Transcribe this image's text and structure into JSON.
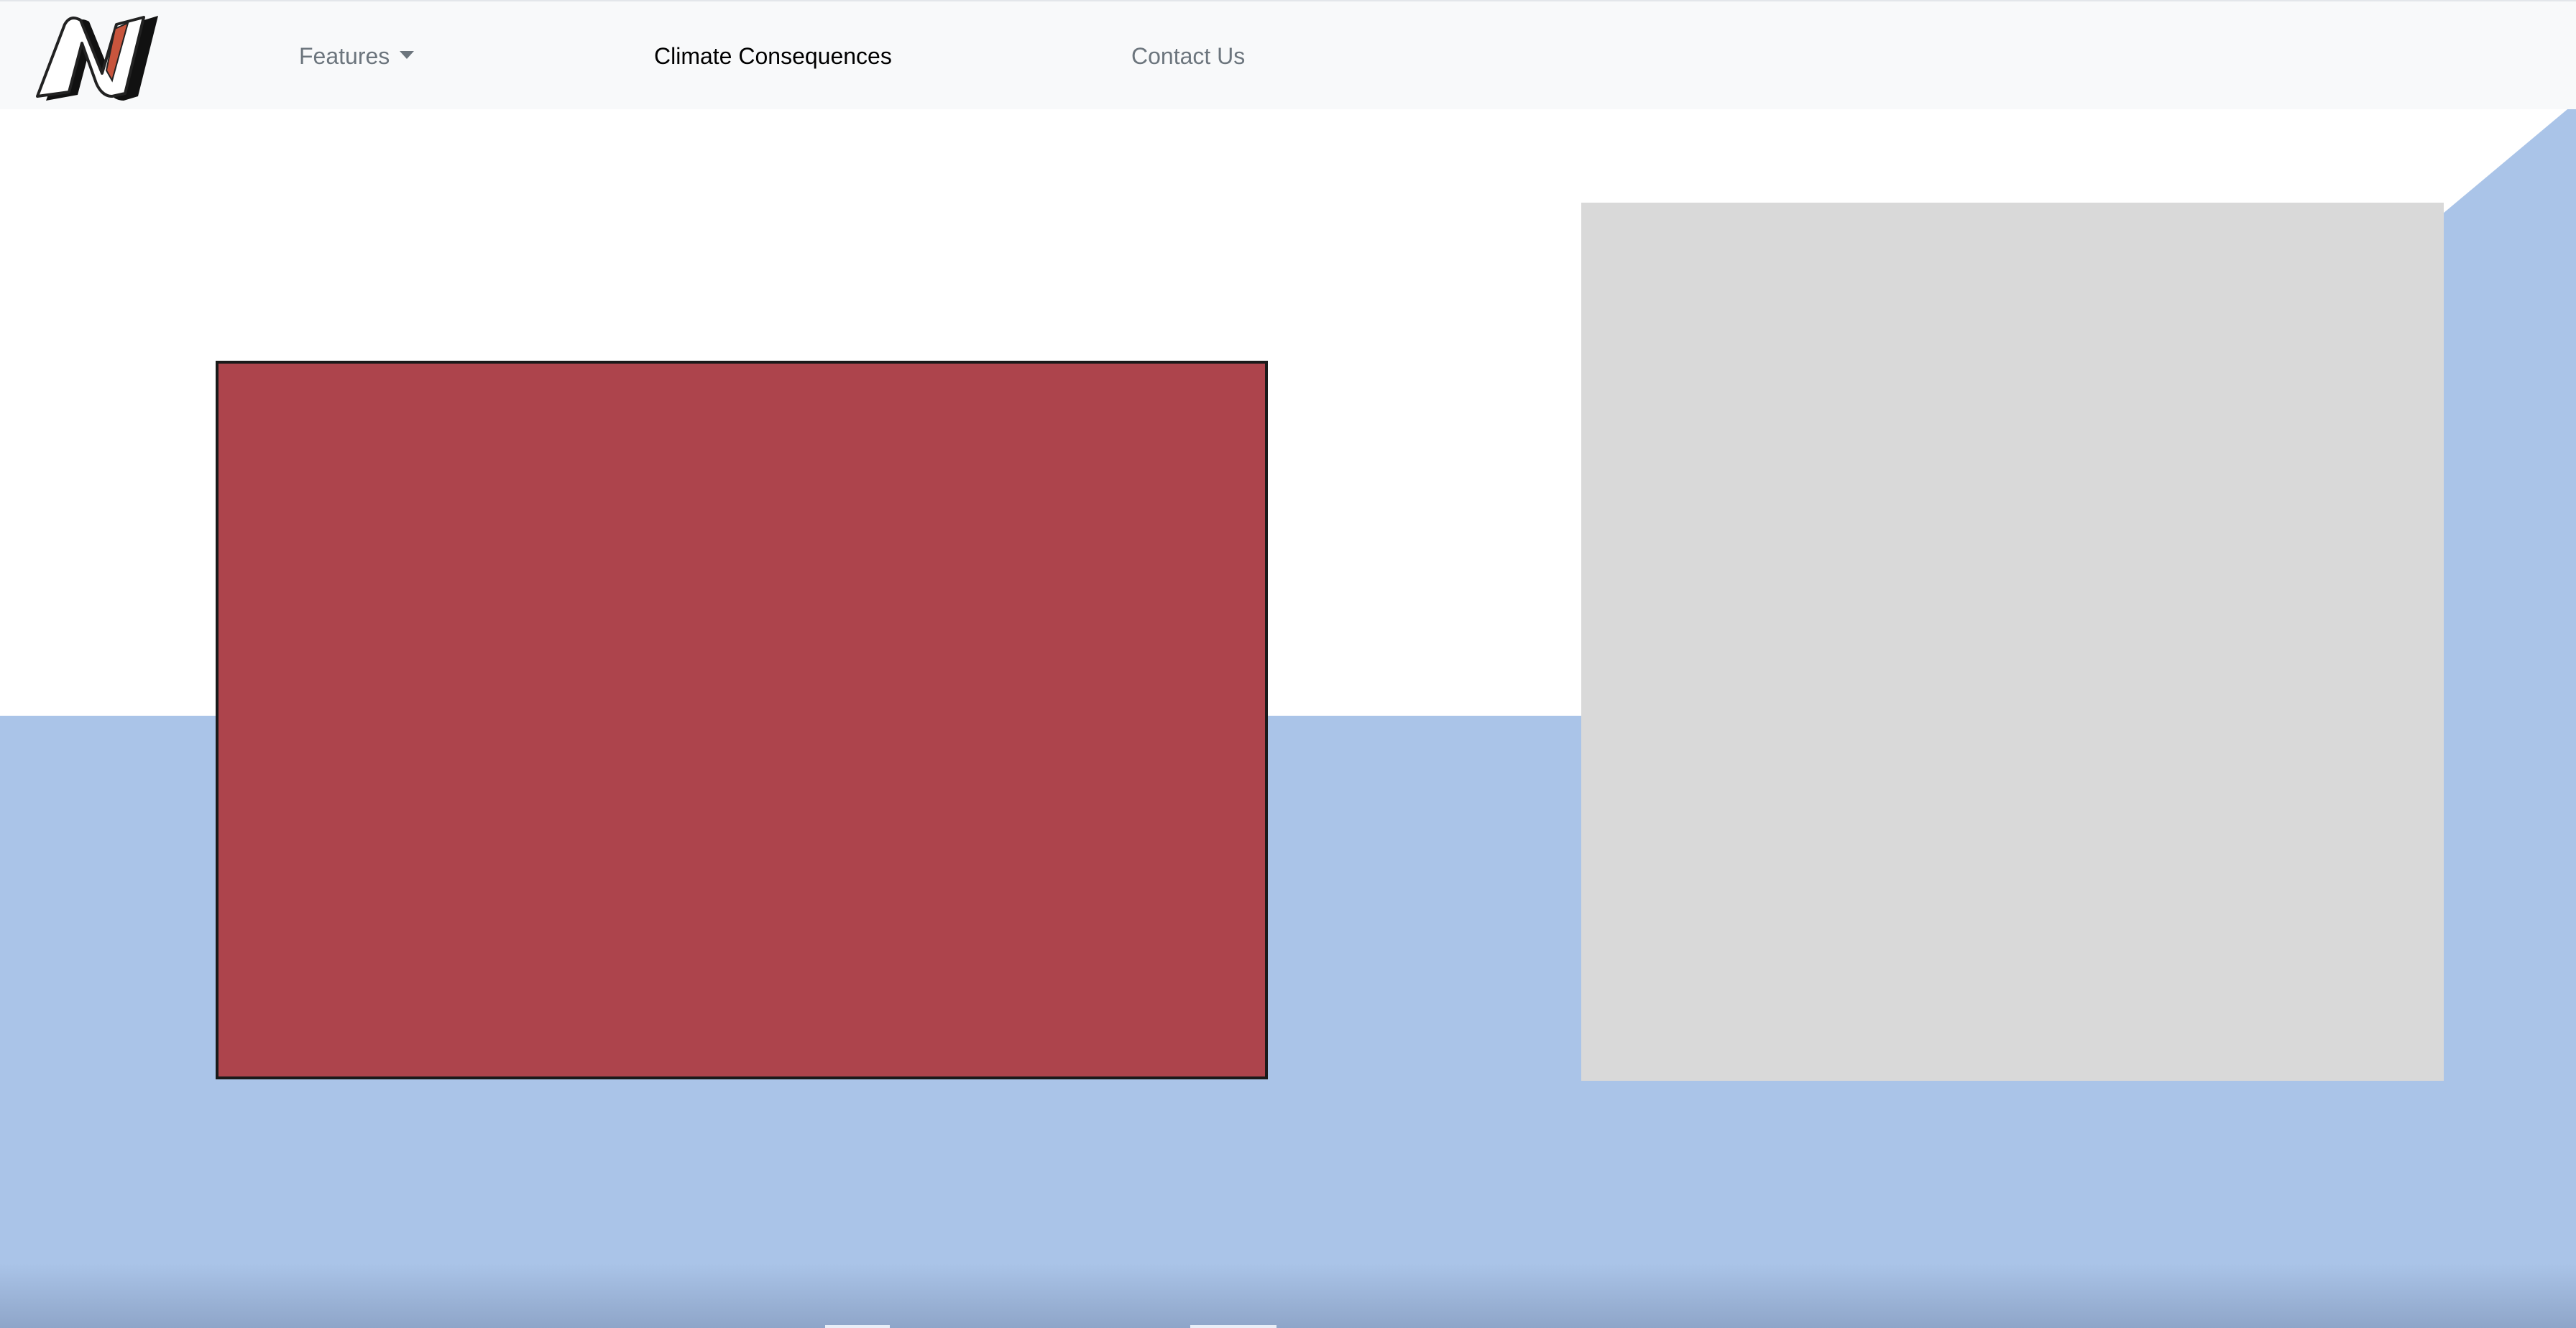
{
  "navbar": {
    "logo_icon": "brand-n-logo-icon",
    "items": [
      {
        "label": "Features",
        "has_dropdown": true,
        "active": false
      },
      {
        "label": "Climate Consequences",
        "has_dropdown": false,
        "active": true
      },
      {
        "label": "Contact Us",
        "has_dropdown": false,
        "active": false
      }
    ]
  },
  "colors": {
    "navbar_bg": "#f8f9fa",
    "nav_link": "#6c757d",
    "nav_link_active": "#000000",
    "blue_band": "#aac4e8",
    "red_panel": "#ad444c",
    "gray_panel": "#d9d9d9",
    "logo_accent": "#c8553d"
  }
}
